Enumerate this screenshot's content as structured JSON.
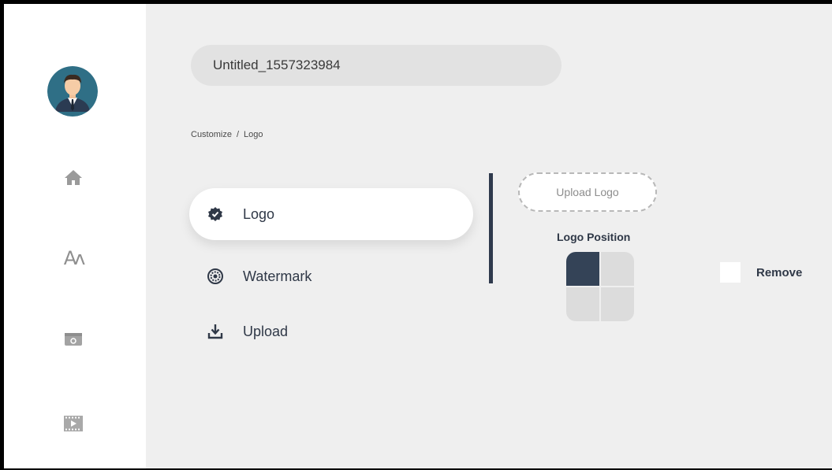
{
  "project": {
    "title_value": "Untitled_1557323984"
  },
  "breadcrumb": {
    "parent": "Customize",
    "separator": "/",
    "current": "Logo"
  },
  "sidebar": {
    "items": [
      {
        "icon": "home-icon"
      },
      {
        "icon": "text-icon",
        "label": "Aʌ"
      },
      {
        "icon": "media-icon"
      },
      {
        "icon": "video-icon"
      }
    ]
  },
  "menu": {
    "items": [
      {
        "label": "Logo",
        "icon": "badge-check-icon",
        "active": true
      },
      {
        "label": "Watermark",
        "icon": "watermark-icon",
        "active": false
      },
      {
        "label": "Upload",
        "icon": "download-tray-icon",
        "active": false
      }
    ]
  },
  "logo_panel": {
    "upload_label": "Upload Logo",
    "position_label": "Logo Position",
    "selected_position": "top-left",
    "remove_label": "Remove",
    "remove_checked": false
  },
  "colors": {
    "accent_dark": "#344357",
    "background": "#efefef",
    "sidebar": "#ffffff"
  }
}
